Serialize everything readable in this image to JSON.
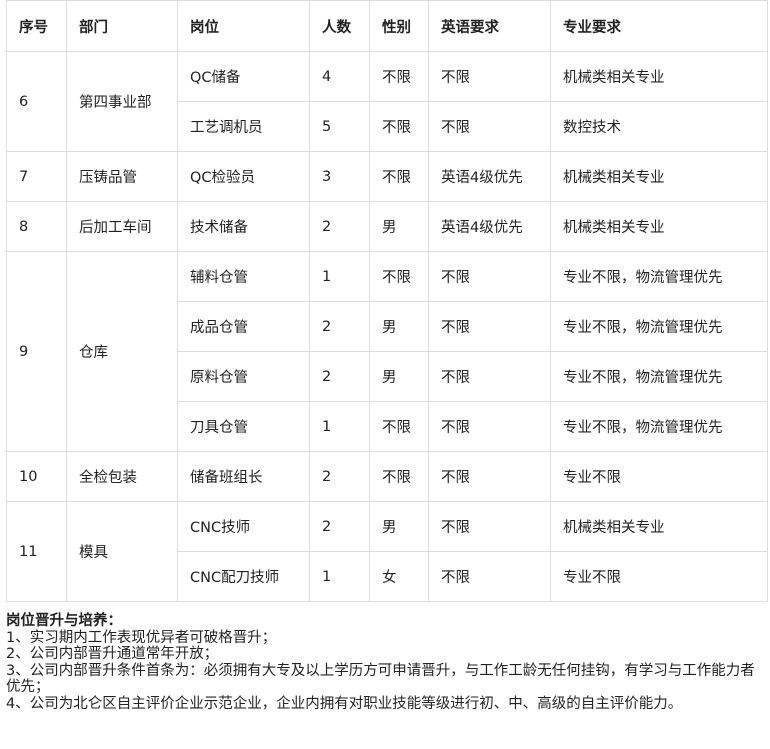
{
  "headers": [
    "序号",
    "部门",
    "岗位",
    "人数",
    "性别",
    "英语要求",
    "专业要求"
  ],
  "groups": [
    {
      "no": "6",
      "dept": "第四事业部",
      "rows": [
        {
          "post": "QC储备",
          "count": "4",
          "gender": "不限",
          "english": "不限",
          "major": "机械类相关专业"
        },
        {
          "post": "工艺调机员",
          "count": "5",
          "gender": "不限",
          "english": "不限",
          "major": "数控技术"
        }
      ]
    },
    {
      "no": "7",
      "dept": "压铸品管",
      "rows": [
        {
          "post": "QC检验员",
          "count": "3",
          "gender": "不限",
          "english": "英语4级优先",
          "major": "机械类相关专业"
        }
      ]
    },
    {
      "no": "8",
      "dept": "后加工车间",
      "rows": [
        {
          "post": "技术储备",
          "count": "2",
          "gender": "男",
          "english": "英语4级优先",
          "major": "机械类相关专业"
        }
      ]
    },
    {
      "no": "9",
      "dept": "仓库",
      "rows": [
        {
          "post": "辅料仓管",
          "count": "1",
          "gender": "不限",
          "english": "不限",
          "major": "专业不限，物流管理优先"
        },
        {
          "post": "成品仓管",
          "count": "2",
          "gender": "男",
          "english": "不限",
          "major": "专业不限，物流管理优先"
        },
        {
          "post": "原料仓管",
          "count": "2",
          "gender": "男",
          "english": "不限",
          "major": "专业不限，物流管理优先"
        },
        {
          "post": "刀具仓管",
          "count": "1",
          "gender": "不限",
          "english": "不限",
          "major": "专业不限，物流管理优先"
        }
      ]
    },
    {
      "no": "10",
      "dept": "全检包装",
      "rows": [
        {
          "post": "储备班组长",
          "count": "2",
          "gender": "不限",
          "english": "不限",
          "major": "专业不限"
        }
      ]
    },
    {
      "no": "11",
      "dept": "模具",
      "rows": [
        {
          "post": "CNC技师",
          "count": "2",
          "gender": "男",
          "english": "不限",
          "major": "机械类相关专业"
        },
        {
          "post": "CNC配刀技师",
          "count": "1",
          "gender": "女",
          "english": "不限",
          "major": "专业不限"
        }
      ]
    }
  ],
  "notes": {
    "heading": "岗位晋升与培养：",
    "items": [
      "1、实习期内工作表现优异者可破格晋升；",
      "2、公司内部晋升通道常年开放；",
      "3、公司内部晋升条件首条为：必须拥有大专及以上学历方可申请晋升，与工作工龄无任何挂钩，有学习与工作能力者优先；",
      "4、公司为北仑区自主评价企业示范企业，企业内拥有对职业技能等级进行初、中、高级的自主评价能力。"
    ]
  }
}
